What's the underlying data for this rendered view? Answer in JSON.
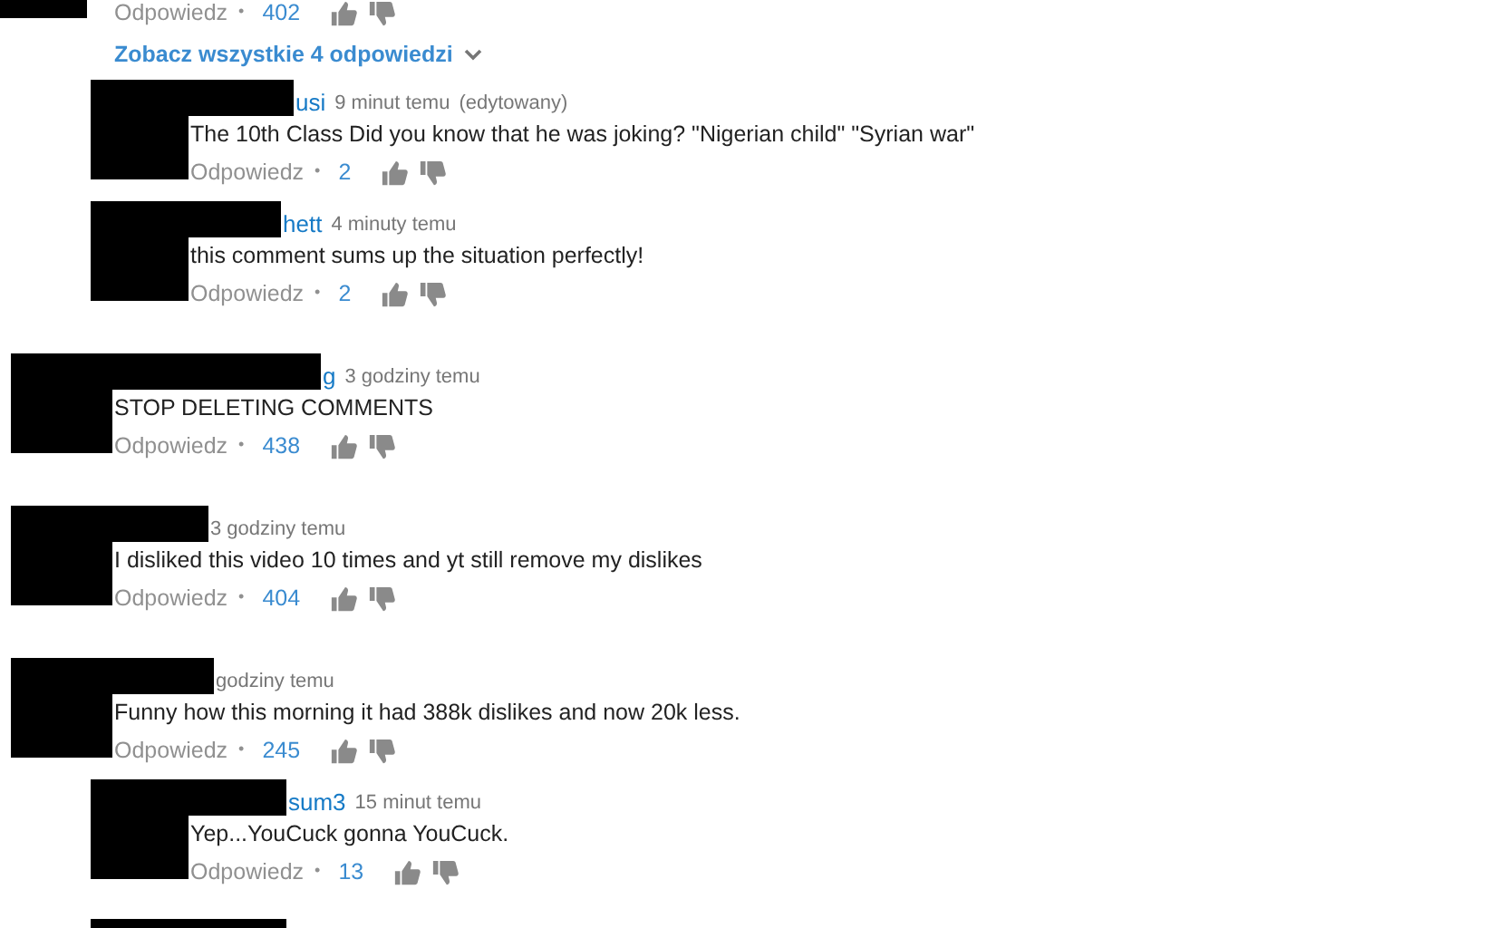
{
  "partial_comment": {
    "reply_label": "Odpowiedz",
    "separator": "•",
    "likes": "402"
  },
  "view_replies": {
    "label": "Zobacz wszystkie 4 odpowiedzi"
  },
  "comments": [
    {
      "kind": "reply",
      "author": "usi",
      "time": "9 minut temu",
      "edited_label": "(edytowany)",
      "text": "The 10th Class Did you know that he was joking? \"Nigerian child\" \"Syrian war\"",
      "reply_label": "Odpowiedz",
      "separator": "•",
      "likes": "2"
    },
    {
      "kind": "reply",
      "author": "hett",
      "time": "4 minuty temu",
      "text": "this comment sums up the situation perfectly!",
      "reply_label": "Odpowiedz",
      "separator": "•",
      "likes": "2"
    },
    {
      "kind": "comment",
      "author": "g",
      "time": "3 godziny temu",
      "text": "STOP DELETING COMMENTS",
      "reply_label": "Odpowiedz",
      "separator": "•",
      "likes": "438"
    },
    {
      "kind": "comment",
      "time": "3 godziny temu",
      "text": "I disliked this video 10 times and yt still remove my dislikes",
      "reply_label": "Odpowiedz",
      "separator": "•",
      "likes": "404"
    },
    {
      "kind": "comment",
      "time": "godziny temu",
      "text": "Funny how this morning it had 388k dislikes and now 20k less.",
      "reply_label": "Odpowiedz",
      "separator": "•",
      "likes": "245"
    },
    {
      "kind": "reply",
      "author": "sum3",
      "time": "15 minut temu",
      "text": "Yep...YouCuck gonna YouCuck.",
      "reply_label": "Odpowiedz",
      "separator": "•",
      "likes": "13"
    }
  ]
}
